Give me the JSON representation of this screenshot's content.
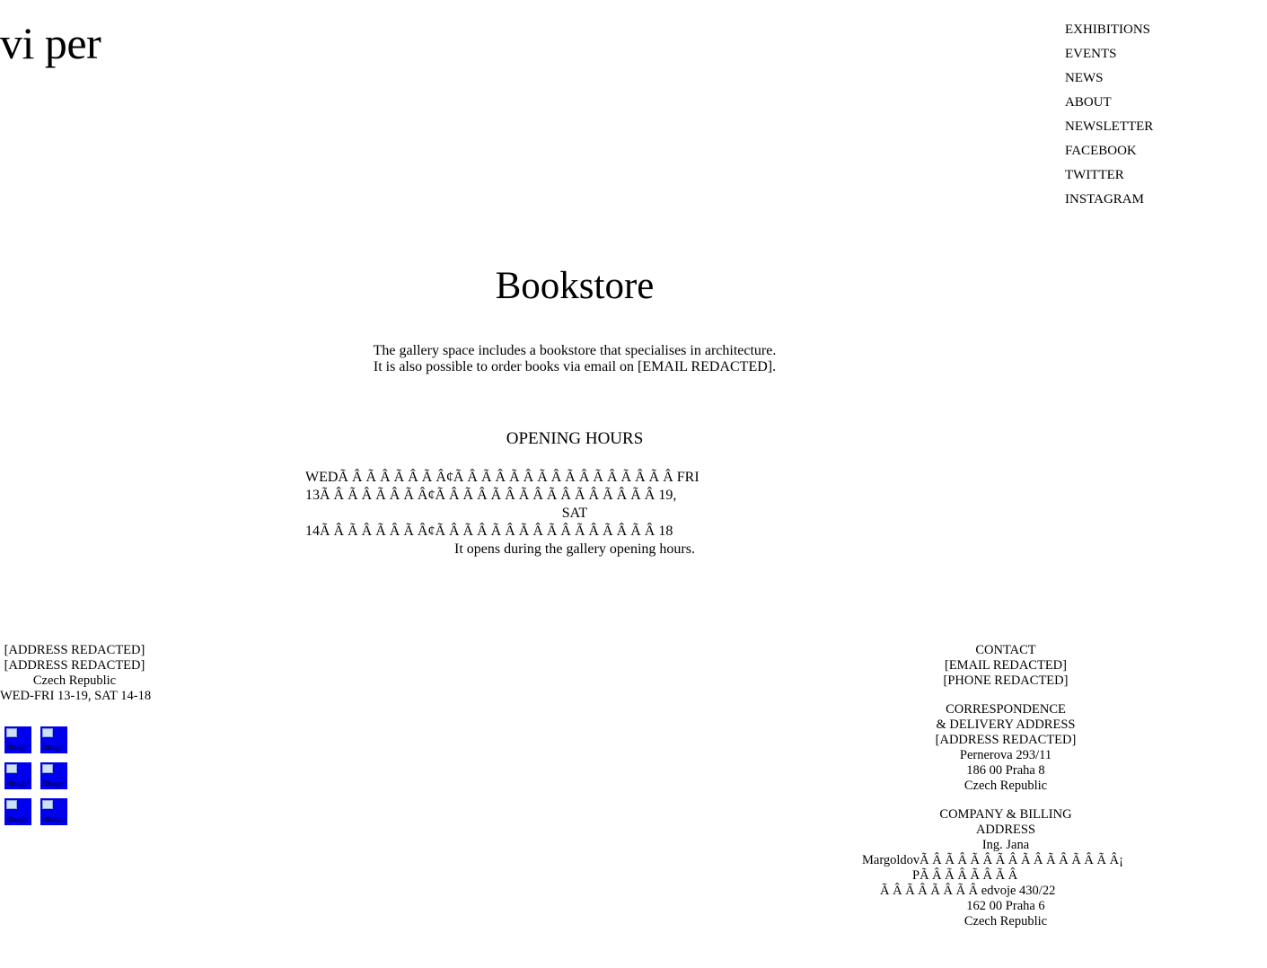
{
  "logo": "vi per",
  "nav": {
    "items": [
      "EXHIBITIONS",
      "EVENTS",
      "NEWS",
      "ABOUT",
      "NEWSLETTER",
      "FACEBOOK",
      "TWITTER",
      "INSTAGRAM"
    ]
  },
  "page": {
    "title": "Bookstore",
    "intro": [
      "The gallery space includes a bookstore that specialises in architecture.",
      "It is also possible to order books via email on [EMAIL REDACTED]."
    ]
  },
  "hours": {
    "heading": "OPENING HOURS",
    "lines": [
      "WEDÃ   Â   Ã   Â   Ã   Â   Ã   Â¢Ã   Â   Ã   Â   Ã   Â   Ã   Â   Ã   Â   Ã   Â   Ã   Â   Ã   Â   FRI",
      "13Ã   Â   Ã   Â   Ã   Â   Ã   Â¢Ã   Â   Ã   Â   Ã   Â   Ã   Â   Ã   Â   Ã   Â   Ã   Â   Ã   Â   19,",
      "SAT",
      "14Ã   Â   Ã   Â   Ã   Â   Ã   Â¢Ã   Â   Ã   Â   Ã   Â   Ã   Â   Ã   Â   Ã   Â   Ã   Â   Ã   Â   18"
    ],
    "note": "It opens during the gallery opening hours."
  },
  "footer_left": {
    "lines": [
      "[ADDRESS REDACTED]",
      "[ADDRESS REDACTED]",
      "Czech Republic",
      "WED-FRI 13-19, SAT 14-18"
    ],
    "image_alt": "Image"
  },
  "footer_right": {
    "contact": [
      "CONTACT",
      "[EMAIL REDACTED]",
      "[PHONE REDACTED]"
    ],
    "correspondence": [
      "CORRESPONDENCE",
      "& DELIVERY ADDRESS",
      "[ADDRESS REDACTED]",
      "Pernerova 293/11",
      "186 00 Praha 8",
      "Czech Republic"
    ],
    "billing_heading": [
      "COMPANY & BILLING",
      "ADDRESS",
      "Ing. Jana"
    ],
    "billing_mojibake": [
      "MargoldovÃ   Â   Ã   Â   Ã   Â   Ã   Â   Ã   Â   Ã   Â   Ã   Â   Ã   Â¡",
      "PÃ   Â   Ã   Â   Ã   Â   Ã   Â",
      "Ã   Â   Ã   Â   Ã   Â   Ã   Â   edvoje 430/22"
    ],
    "billing_tail": [
      "162 00 Praha 6",
      "Czech Republic"
    ]
  }
}
